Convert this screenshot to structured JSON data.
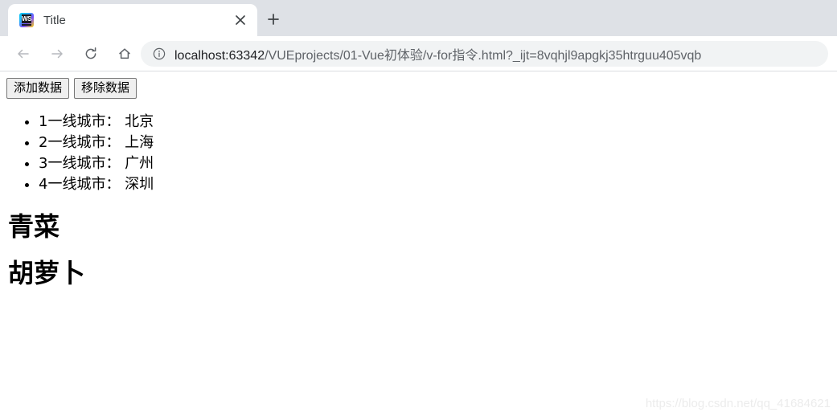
{
  "browser": {
    "tab": {
      "title": "Title",
      "favicon_name": "webstorm-icon",
      "favicon_text": "WS",
      "close_label": "×"
    },
    "new_tab_label": "+",
    "nav": {
      "back_label": "←",
      "forward_label": "→",
      "reload_label": "⟳",
      "home_label": "⌂"
    },
    "omnibox": {
      "host": "localhost:63342",
      "path": "/VUEprojects/01-Vue初体验/v-for指令.html?_ijt=8vqhjl9apgkj35htrguu405vqb",
      "full_url": "localhost:63342/VUEprojects/01-Vue初体验/v-for指令.html?_ijt=8vqhjl9apgkj35htrguu405vqb",
      "security_icon": "info-circle-icon"
    },
    "colors": {
      "tabstrip_bg": "#dee1e6",
      "toolbar_bg": "#ffffff",
      "omnibox_bg": "#f1f3f4",
      "divider": "#dadce0"
    }
  },
  "page": {
    "buttons": [
      {
        "label": "添加数据",
        "name": "add-data-button"
      },
      {
        "label": "移除数据",
        "name": "remove-data-button"
      }
    ],
    "city_list": [
      "1一线城市： 北京",
      "2一线城市： 上海",
      "3一线城市： 广州",
      "4一线城市： 深圳"
    ],
    "headings": [
      "青菜",
      "胡萝卜"
    ],
    "watermark": "https://blog.csdn.net/qq_41684621"
  }
}
